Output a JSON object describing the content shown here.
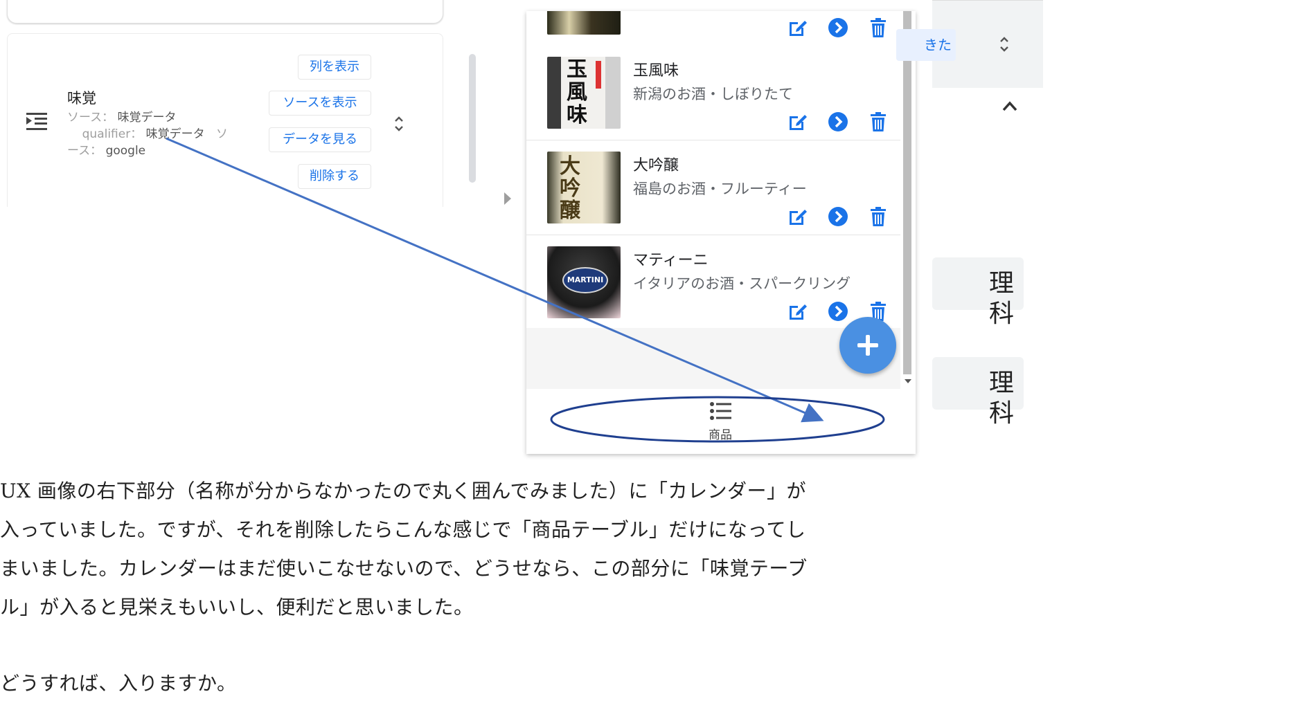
{
  "column_panel": {
    "column_name": "味覚",
    "source_label": "ソース：",
    "source_value": "味覚データ",
    "qualifier_label": "qualifier：",
    "qualifier_value": "味覚データ",
    "source2_label_a": "ソ",
    "source2_label_b": "ース：",
    "source2_value": "google",
    "buttons": [
      "列を表示",
      "ソースを表示",
      "データを見る",
      "削除する"
    ]
  },
  "app_preview": {
    "items": [
      {
        "name": "玉風味",
        "description": "新潟のお酒・しぼりたて",
        "label_text": "玉風味"
      },
      {
        "name": "大吟醸",
        "description": "福島のお酒・フルーティー",
        "label_text": "大吟醸"
      },
      {
        "name": "マティーニ",
        "description": "イタリアのお酒・スパークリング",
        "label_text": "MARTINI"
      }
    ],
    "bottom_nav": {
      "label": "商品",
      "icon": "list-icon"
    },
    "fab_icon": "plus-icon",
    "accent_color": "#1a73e8"
  },
  "right_panel": {
    "button_partial": "きた",
    "card_1": {
      "line1": "理",
      "line2": "科"
    },
    "card_2": {
      "line1": "理",
      "line2": "科"
    }
  },
  "body": {
    "paragraph_lines": [
      "UX 画像の右下部分（名称が分からなかったので丸く囲んでみました）に「カレンダー」が",
      "入っていました。ですが、それを削除したらこんな感じで「商品テーブル」だけになってし",
      "まいました。カレンダーはまだ使いこなせないので、どうせなら、この部分に「味覚テーブ",
      "ル」が入ると見栄えもいいし、便利だと思いました。"
    ],
    "question": "どうすれば、入りますか。"
  },
  "annotation": {
    "line_color": "#4472c4",
    "ellipse_color": "#1f3f8f"
  }
}
